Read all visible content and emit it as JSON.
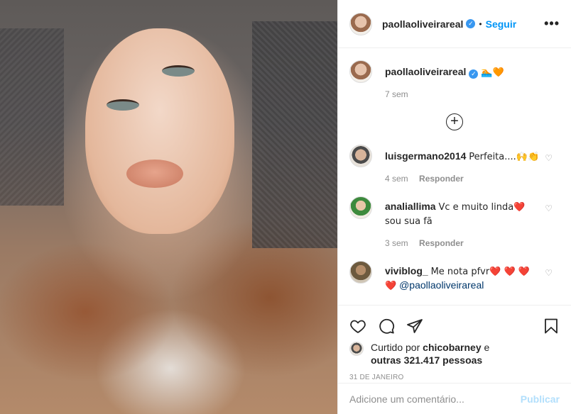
{
  "post": {
    "author": "paollaoliveirareal",
    "follow_label": "Seguir",
    "more_label": "•••",
    "separator": "•",
    "verified_mark": "✓",
    "caption_emojis": "🏊🧡",
    "caption_age": "7 sem"
  },
  "icons": {
    "plus": "+",
    "heart_small": "♡"
  },
  "comments": [
    {
      "user": "luisgermano2014",
      "text": "Perfeita....🙌👏",
      "age": "4 sem",
      "reply": "Responder"
    },
    {
      "user": "analiallima",
      "text": "Vc e muito linda❤️ sou sua fã",
      "age": "3 sem",
      "reply": "Responder"
    },
    {
      "user": "viviblog_",
      "text": "Me nota pfvr❤️ ❤️ ❤️ ❤️",
      "mention": "@paollaoliveirareal"
    }
  ],
  "likes": {
    "prefix": "Curtido por",
    "user": "chicobarney",
    "suffix": "e",
    "others": "outras 321.417 pessoas"
  },
  "date": "31 DE JANEIRO",
  "add_comment": {
    "placeholder": "Adicione um comentário...",
    "post_label": "Publicar"
  },
  "colors": {
    "accent": "#0095f6",
    "verified": "#3897f0",
    "muted": "#8e8e8e",
    "publish_disabled": "#b2dffc"
  }
}
